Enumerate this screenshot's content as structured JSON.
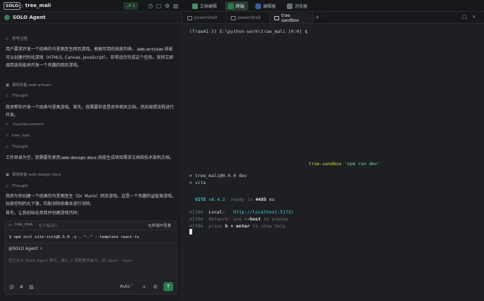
{
  "topbar": {
    "logo": "SOLO",
    "project": "tree_mali",
    "branch_badge": "1",
    "tabs": [
      {
        "label": "文档编辑",
        "active": false
      },
      {
        "label": "终端",
        "active": true
      },
      {
        "label": "编辑器",
        "active": false
      },
      {
        "label": "浏览器",
        "active": false
      }
    ]
  },
  "agent": {
    "title": "SOLO Agent",
    "lines": [
      {
        "icon": "brain-icon",
        "text": "思考过程",
        "style": "small"
      },
      {
        "text_before": "用户要求开发一个经典的马里奥医生网页游戏。根据可用的技能列表，",
        "code": "web-artisan",
        "text_after": "技能可以创建代码化游戏（HTML5, Canvas, JavaScript），非常适合完成这个任务。我将立即调用该技能来开发一个有趣的网页游戏。"
      },
      {
        "icon": "tool-icon",
        "text": "调用技能 web-artisan",
        "style": "small"
      },
      {
        "icon": "brain-icon",
        "text": "Thought",
        "style": "small"
      },
      {
        "text": "我来帮你开发一个经典马里奥游戏。首先，我需要检查是否有相关文档，然后按照流程进行开发。"
      },
      {
        "icon": "link-icon",
        "text": ".trae/documents",
        "style": "small"
      },
      {
        "icon": "link-icon",
        "text": "tree_mali",
        "style": "small"
      },
      {
        "icon": "brain-icon",
        "text": "Thought",
        "style": "small"
      },
      {
        "text_before": "工作目录为空，我需要先使用",
        "code": "web-design-docs",
        "text_after": "技能生成项目需求文档和技术架构文档。"
      },
      {
        "icon": "tool-icon",
        "text": "调用技能 web-design-docs",
        "style": "small"
      },
      {
        "icon": "brain-icon",
        "text": "Thought",
        "style": "small"
      },
      {
        "text": "我将为你创建一个经典的马里奥医生（Dr. Mario）网页游戏。这是一个有趣的益智类游戏，玩家控制药丸下落，匹配消除病毒来进行消除。"
      },
      {
        "text": "首先，让我初始化项目并创建游戏代码："
      }
    ],
    "terminal_card": {
      "label": "tree_mali",
      "sub": "在沙箱运行",
      "action": "在终端中查看",
      "command": "$ npm init vite-init@6.5.0 -y . \"--\" --template react-ts"
    },
    "input": {
      "mention": "@SOLO Agent",
      "placeholder": "您正在与 SOLO Agent 聊天，输入 '/' 获取更多能力，如 '/plan', '/spec'",
      "mode": "Auto"
    }
  },
  "terminal": {
    "tabs": [
      {
        "label": "powershell",
        "active": false
      },
      {
        "label": "powershell",
        "active": false
      },
      {
        "label": "trae-sandbox",
        "active": true
      }
    ],
    "prompt": "(TraeAI-3) E:\\python-work\\trae_mali [0:0] $",
    "sandbox_name": "trae-sandbox",
    "sandbox_cmd": "'npm run dev'",
    "run_line": "> tree_mali@0.0.0 dev",
    "vite_line": "> vite",
    "vite_label": "VITE",
    "vite_version": "v6.4.2",
    "ready_text": "ready in",
    "ready_ms": "4485",
    "ready_unit": "ms",
    "esc": "\u0000[39m",
    "local_label": "Local:",
    "local_url": "http://localhost:5173/",
    "network_text_1": "Network: use ",
    "network_flag": "--host",
    "network_text_2": " to expose",
    "help_text_1": "press ",
    "help_key": "h + enter",
    "help_text_2": " to show help"
  }
}
